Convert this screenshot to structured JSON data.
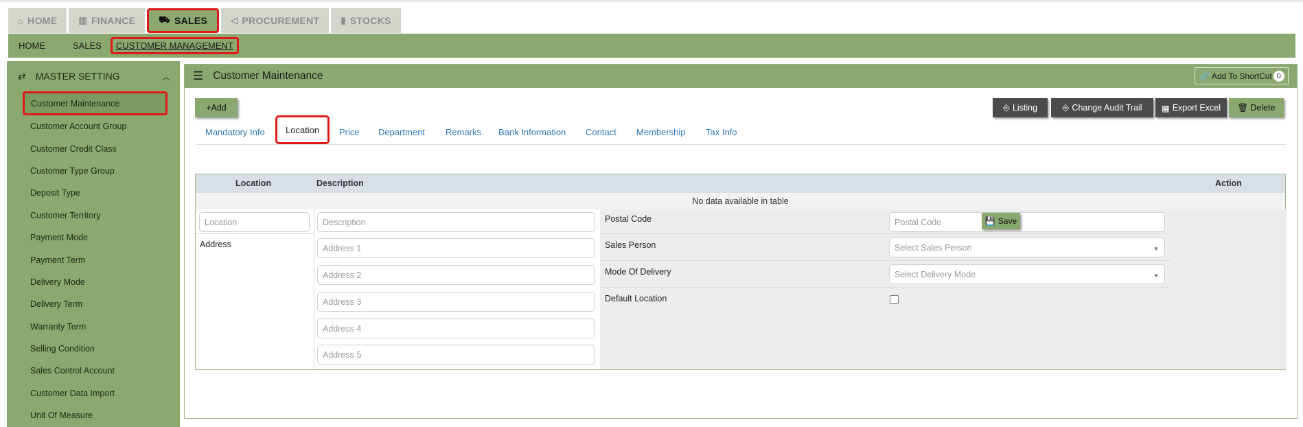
{
  "top_tabs": [
    {
      "label": "HOME",
      "icon": "home-icon",
      "glyph": "⌂"
    },
    {
      "label": "FINANCE",
      "icon": "bank-icon",
      "glyph": "🏛"
    },
    {
      "label": "SALES",
      "icon": "cart-icon",
      "glyph": "🛒",
      "active": true
    },
    {
      "label": "PROCUREMENT",
      "icon": "megaphone-icon",
      "glyph": "📢"
    },
    {
      "label": "STOCKS",
      "icon": "bar-chart-icon",
      "glyph": "📊"
    }
  ],
  "breadcrumb": [
    "HOME",
    "SALES",
    "CUSTOMER MANAGEMENT"
  ],
  "sidebar": {
    "header": "MASTER SETTING",
    "items": [
      {
        "label": "Customer Maintenance",
        "active": true
      },
      {
        "label": "Customer Account Group"
      },
      {
        "label": "Customer Credit Class"
      },
      {
        "label": "Customer Type Group"
      },
      {
        "label": "Deposit Type"
      },
      {
        "label": "Customer Territory"
      },
      {
        "label": "Payment Mode"
      },
      {
        "label": "Payment Term"
      },
      {
        "label": "Delivery Mode"
      },
      {
        "label": "Delivery Term"
      },
      {
        "label": "Warranty Term"
      },
      {
        "label": "Selling Condition"
      },
      {
        "label": "Sales Control Account"
      },
      {
        "label": "Customer Data Import"
      },
      {
        "label": "Unit Of Measure"
      }
    ]
  },
  "panel": {
    "title": "Customer Maintenance",
    "shortcut_label": "Add To ShortCut",
    "shortcut_count": "0"
  },
  "buttons": {
    "add": "+Add",
    "listing": "Listing",
    "audit": "Change Audit Trail",
    "export": "Export Excel",
    "delete": "Delete"
  },
  "tabs": [
    "Mandatory Info",
    "Location",
    "Price",
    "Department",
    "Remarks",
    "Bank Information",
    "Contact",
    "Membership",
    "Tax Info"
  ],
  "active_tab": "Location",
  "table": {
    "headers": {
      "location": "Location",
      "description": "Description",
      "action": "Action"
    },
    "empty_text": "No data available in table",
    "placeholders": {
      "location": "Location",
      "description": "Description",
      "address1": "Address 1",
      "address2": "Address 2",
      "address3": "Address 3",
      "address4": "Address 4",
      "address5": "Address 5",
      "postal_code": "Postal Code",
      "sales_person": "Select Sales Person",
      "delivery_mode": "Select Delivery Mode"
    },
    "labels": {
      "address": "Address",
      "postal_code": "Postal Code",
      "sales_person": "Sales Person",
      "mode_of_delivery": "Mode Of Delivery",
      "default_location": "Default Location"
    },
    "save_label": "Save"
  },
  "colors": {
    "accent_green": "#8aa86f",
    "highlight_red": "#e01818",
    "link_blue": "#3277b4"
  }
}
